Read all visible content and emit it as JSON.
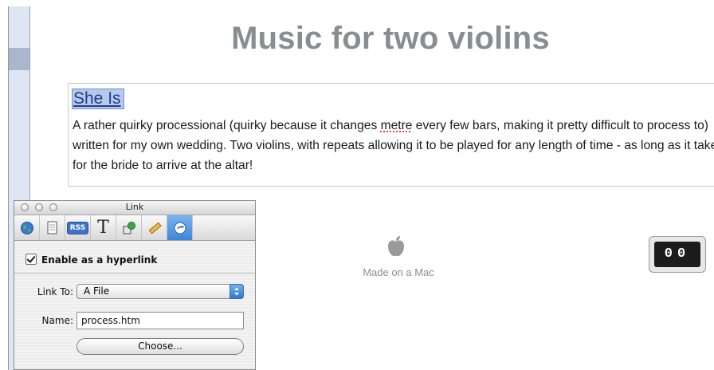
{
  "page": {
    "title": "Music for two violins",
    "link_text": "She Is",
    "body_text": {
      "before": "A rather quirky processional (quirky because it changes ",
      "misspelled": "metre",
      "after": " every few bars, making it pretty difficult to process to) written for my own wedding. Two violins, with repeats allowing it to be played for any length of time - as long as it takes for the bride to arrive at the altar!"
    },
    "made_on": "Made on a Mac",
    "counter": "00"
  },
  "inspector": {
    "title": "Link",
    "toolbar": [
      {
        "icon": "globe-icon"
      },
      {
        "icon": "document-icon"
      },
      {
        "icon": "rss-icon",
        "text": "RSS"
      },
      {
        "icon": "text-icon",
        "text": "T"
      },
      {
        "icon": "shapes-icon"
      },
      {
        "icon": "ruler-icon"
      },
      {
        "icon": "link-arrow-icon",
        "active": true
      }
    ],
    "enable_label": "Enable as a hyperlink",
    "link_to_label": "Link To:",
    "link_to_value": "A File",
    "name_label": "Name:",
    "name_value": "process.htm",
    "choose_label": "Choose..."
  },
  "colors": {
    "title_gray": "#8a8c91",
    "link_blue": "#1e3c8c",
    "selection": "#b6c9ea",
    "aqua_blue": "#3d86d6"
  }
}
